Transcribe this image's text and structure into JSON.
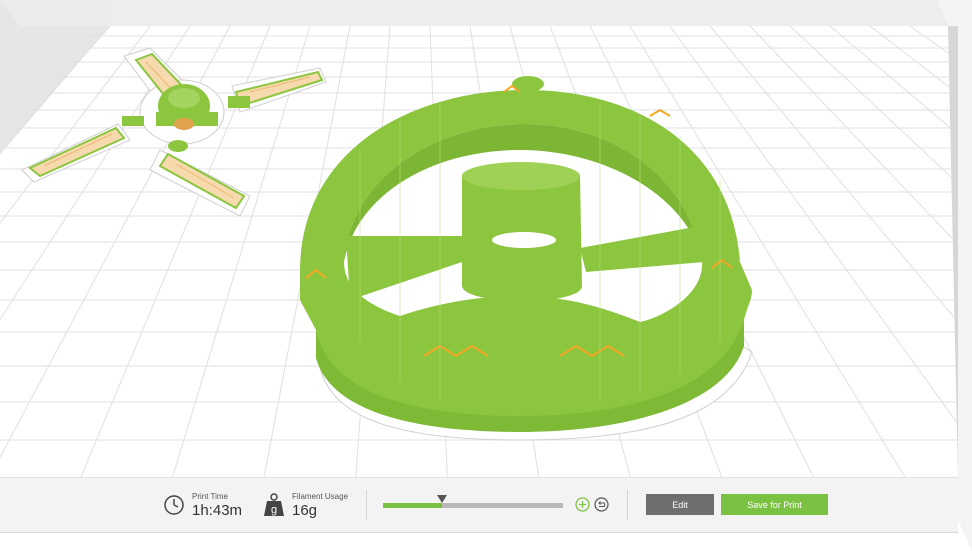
{
  "viewport": {
    "model_color": "#8cc63f",
    "support_color": "#f5a623",
    "grid_color": "#e3e3e3"
  },
  "bottom_bar": {
    "print_time": {
      "label": "Print Time",
      "value": "1h:43m",
      "icon": "clock-icon"
    },
    "filament": {
      "label": "Filament Usage",
      "value": "16g",
      "icon": "weight-icon",
      "icon_glyph": "g"
    },
    "quality_slider": {
      "level": 0.33,
      "fill_color": "#7cc242",
      "track_color": "#b9b9b9"
    },
    "add_button": {
      "icon": "plus-circle-icon"
    },
    "reset_button": {
      "icon": "reset-circle-icon"
    },
    "edit_button": {
      "label": "Edit",
      "color": "#6e6e6e"
    },
    "save_button": {
      "label": "Save for Print",
      "color": "#7cc242"
    }
  }
}
